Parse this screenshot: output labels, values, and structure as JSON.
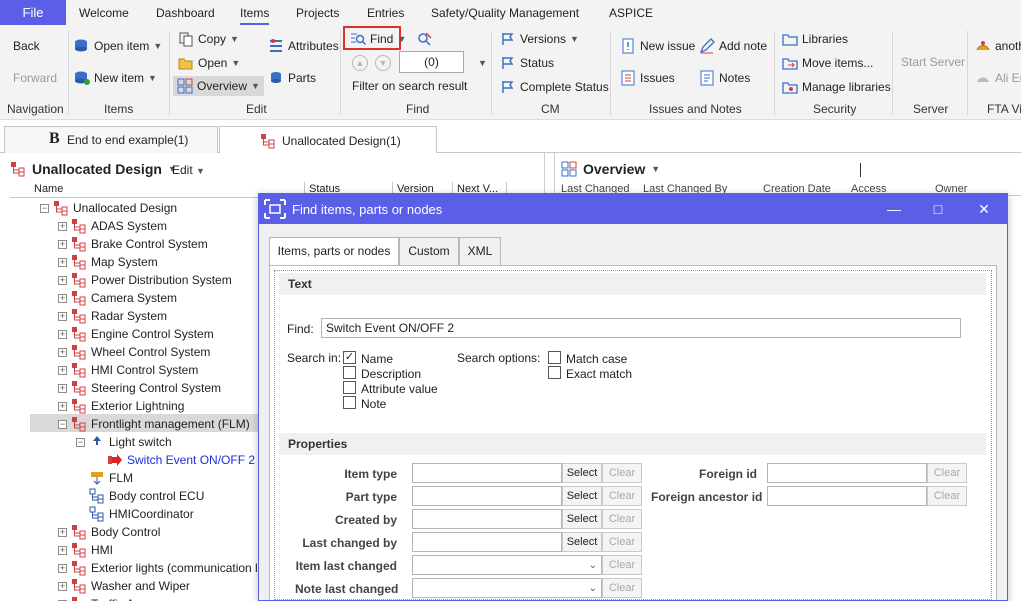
{
  "menu": {
    "file": "File",
    "items": [
      "Welcome",
      "Dashboard",
      "Items",
      "Projects",
      "Entries",
      "Safety/Quality Management",
      "ASPICE"
    ]
  },
  "ribbon": {
    "navigation": {
      "back": "Back",
      "forward": "Forward",
      "group": "Navigation"
    },
    "items": {
      "open_item": "Open item",
      "new_item": "New item",
      "group": "Items"
    },
    "edit": {
      "copy": "Copy",
      "open": "Open",
      "overview": "Overview",
      "attributes": "Attributes",
      "parts": "Parts",
      "group": "Edit"
    },
    "find": {
      "find": "Find",
      "count": "(0)",
      "filter": "Filter on search result",
      "group": "Find"
    },
    "cm": {
      "versions": "Versions",
      "status": "Status",
      "complete_status": "Complete Status",
      "group": "CM"
    },
    "issues": {
      "new_issue": "New issue",
      "add_note": "Add note",
      "issues": "Issues",
      "notes": "Notes",
      "group": "Issues and Notes"
    },
    "security": {
      "libraries": "Libraries",
      "move_items": "Move items...",
      "manage_libraries": "Manage libraries",
      "group": "Security"
    },
    "server": {
      "start_server": "Start Server",
      "group": "Server"
    },
    "fta": {
      "another": "anoth",
      "ali": "Ali Er",
      "group": "FTA Vi"
    }
  },
  "doc_tabs": [
    "End to end example(1)",
    "Unallocated Design(1)"
  ],
  "tree_panel": {
    "title": "Unallocated Design",
    "edit": "Edit",
    "columns": [
      "Name",
      "Status",
      "Version",
      "Next V..."
    ],
    "root": "Unallocated Design",
    "nodes": [
      "ADAS System",
      "Brake Control System",
      "Map System",
      "Power Distribution System",
      "Camera System",
      "Radar System",
      "Engine Control System",
      "Wheel Control System",
      "HMI Control System",
      "Steering Control System",
      "Exterior Lightning",
      "Frontlight management (FLM)",
      "Light switch",
      "Switch Event ON/OFF 2",
      "FLM",
      "Body control ECU",
      "HMICoordinator",
      "Body Control",
      "HMI",
      "Exterior lights (communication li",
      "Washer and Wiper",
      "Traffic A"
    ]
  },
  "overview_panel": {
    "title": "Overview",
    "columns": [
      "Last Changed",
      "Last Changed By",
      "Creation Date",
      "Access",
      "Owner"
    ]
  },
  "dialog": {
    "title": "Find items, parts or nodes",
    "tabs": [
      "Items, parts or nodes",
      "Custom",
      "XML"
    ],
    "text_section": "Text",
    "find_label": "Find:",
    "find_value": "Switch Event ON/OFF 2",
    "search_in_label": "Search in:",
    "search_in": [
      {
        "label": "Name",
        "checked": true
      },
      {
        "label": "Description",
        "checked": false
      },
      {
        "label": "Attribute value",
        "checked": false
      },
      {
        "label": "Note",
        "checked": false
      }
    ],
    "search_options_label": "Search options:",
    "search_options": [
      {
        "label": "Match case",
        "checked": false
      },
      {
        "label": "Exact match",
        "checked": false
      }
    ],
    "properties_section": "Properties",
    "select": "Select",
    "clear": "Clear",
    "props_left": [
      "Item type",
      "Part type",
      "Created by",
      "Last changed by",
      "Item last changed",
      "Note last changed"
    ],
    "props_right": [
      "Foreign id",
      "Foreign ancestor id"
    ]
  }
}
